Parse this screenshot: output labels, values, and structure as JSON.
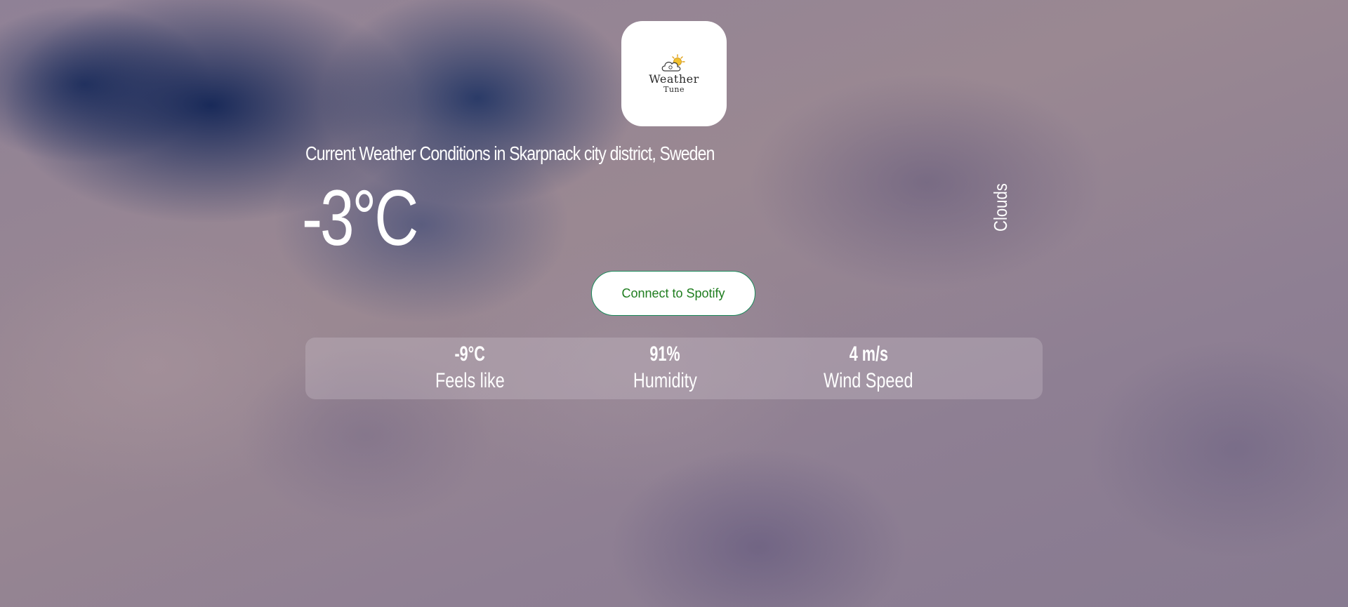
{
  "logo": {
    "name": "Weather",
    "tagline": "Tune",
    "icon": "cloud-sun-icon"
  },
  "location_title": "Current Weather Conditions in Skarpnack city district, Sweden",
  "temperature": "-3°C",
  "condition": "Clouds",
  "spotify_button": {
    "label": "Connect to Spotify"
  },
  "stats": [
    {
      "value": "-9°C",
      "label": "Feels like"
    },
    {
      "value": "91%",
      "label": "Humidity"
    },
    {
      "value": "4 m/s",
      "label": "Wind Speed"
    }
  ],
  "colors": {
    "button_text": "#1f7d1f",
    "button_border": "#1a8a5a",
    "sky_dark": "#14285a",
    "sky_cloud": "#9a8892"
  }
}
